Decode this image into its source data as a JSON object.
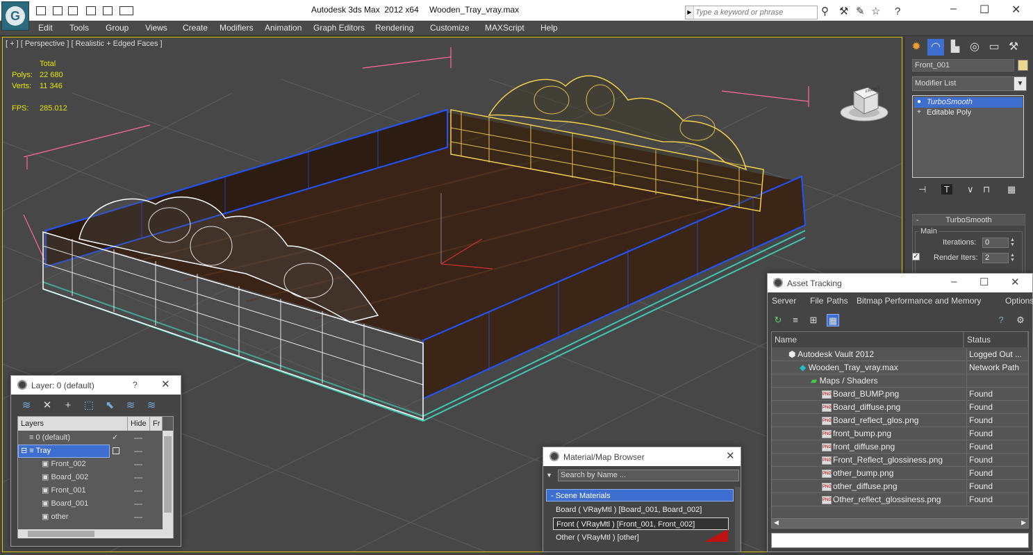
{
  "app": {
    "title": "Autodesk 3ds Max  2012 x64",
    "file": "Wooden_Tray_vray.max",
    "logo_glyph": "G"
  },
  "search": {
    "placeholder": "Type a keyword or phrase"
  },
  "menu": [
    "Edit",
    "Tools",
    "Group",
    "Views",
    "Create",
    "Modifiers",
    "Animation",
    "Graph Editors",
    "Rendering",
    "Customize",
    "MAXScript",
    "Help"
  ],
  "viewport": {
    "label": "[ + ] [ Perspective ] [ Realistic + Edged Faces ]",
    "stats": {
      "total_label": "Total",
      "polys_label": "Polys:",
      "polys": "22 680",
      "verts_label": "Verts:",
      "verts": "11 346",
      "fps_label": "FPS:",
      "fps": "285.012"
    },
    "viewcube_text": "FRONT",
    "colors": {
      "selected_wire": "#f0d050",
      "white_wire": "#ffffff",
      "blue_wire": "#2255ff",
      "cyan_wire": "#40c8b0",
      "wood": "#3a2418",
      "grid": "#5a5a5a",
      "bbox": "#ff6aa0"
    }
  },
  "command_panel": {
    "object_name": "Front_001",
    "modifier_list": "Modifier List",
    "stack": [
      "TurboSmooth",
      "Editable Poly"
    ],
    "turbosmooth": {
      "title": "TurboSmooth",
      "group": "Main",
      "iterations_label": "Iterations:",
      "iterations": "0",
      "render_iters_label": "Render Iters:",
      "render_iters": "2"
    }
  },
  "asset_tracking": {
    "title": "Asset Tracking",
    "menu": [
      "Server",
      "File",
      "Paths",
      "Bitmap Performance and Memory",
      "Options"
    ],
    "columns": {
      "name": "Name",
      "status": "Status"
    },
    "rows": [
      {
        "name": "Autodesk Vault 2012",
        "status": "Logged Out ..."
      },
      {
        "name": "Wooden_Tray_vray.max",
        "status": "Network Path"
      },
      {
        "name": "Maps / Shaders",
        "status": ""
      },
      {
        "name": "Board_BUMP.png",
        "status": "Found"
      },
      {
        "name": "Board_diffuse.png",
        "status": "Found"
      },
      {
        "name": "Board_reflect_glos.png",
        "status": "Found"
      },
      {
        "name": "front_bump.png",
        "status": "Found"
      },
      {
        "name": "front_diffuse.png",
        "status": "Found"
      },
      {
        "name": "Front_Reflect_glossiness.png",
        "status": "Found"
      },
      {
        "name": "other_bump.png",
        "status": "Found"
      },
      {
        "name": "other_diffuse.png",
        "status": "Found"
      },
      {
        "name": "Other_reflect_glossiness.png",
        "status": "Found"
      }
    ],
    "png_badge": "PNG"
  },
  "layer_dialog": {
    "title": "Layer: 0 (default)",
    "help": "?",
    "columns": {
      "layers": "Layers",
      "hide": "Hide",
      "freeze": "Fr"
    },
    "rows": [
      "0 (default)",
      "Tray",
      "Front_002",
      "Board_002",
      "Front_001",
      "Board_001",
      "other"
    ]
  },
  "material_browser": {
    "title": "Material/Map Browser",
    "search_placeholder": "Search by Name ...",
    "group": "- Scene Materials",
    "materials": [
      "Board  ( VRayMtl )  [Board_001, Board_002]",
      "Front  ( VRayMtl )  [Front_001, Front_002]",
      "Other  ( VRayMtl )  [other]"
    ]
  }
}
